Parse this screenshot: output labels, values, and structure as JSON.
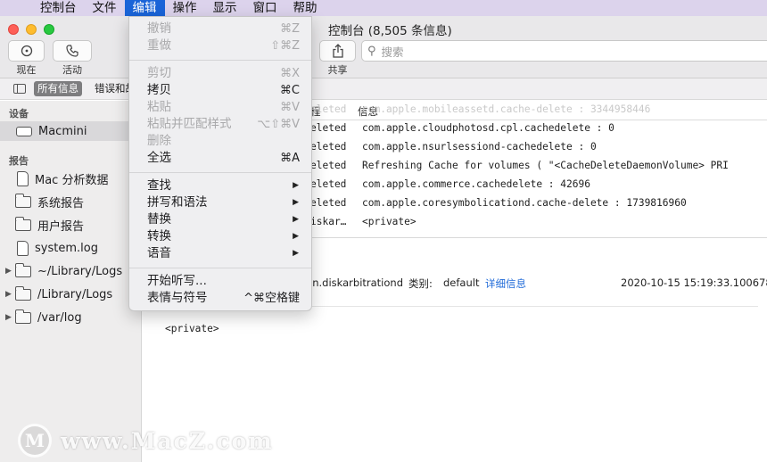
{
  "menubar": {
    "items": [
      {
        "label": "控制台"
      },
      {
        "label": "文件"
      },
      {
        "label": "编辑"
      },
      {
        "label": "操作"
      },
      {
        "label": "显示"
      },
      {
        "label": "窗口"
      },
      {
        "label": "帮助"
      }
    ],
    "active_index": 2
  },
  "window": {
    "title": "控制台 (8,505 条信息)"
  },
  "toolbar": {
    "now_label": "现在",
    "activity_label": "活动",
    "share_label": "共享",
    "search_placeholder": "搜索"
  },
  "filterbar": {
    "all_messages": "所有信息",
    "errors_partial": "错误和故"
  },
  "sidebar": {
    "devices_header": "设备",
    "device": "Macmini",
    "reports_header": "报告",
    "reports": [
      {
        "label": "Mac 分析数据",
        "icon": "document-icon"
      },
      {
        "label": "系统报告",
        "icon": "folder-icon"
      },
      {
        "label": "用户报告",
        "icon": "folder-icon"
      },
      {
        "label": "system.log",
        "icon": "document-icon"
      },
      {
        "label": "~/Library/Logs",
        "icon": "folder-icon",
        "expandable": true
      },
      {
        "label": "/Library/Logs",
        "icon": "folder-icon",
        "expandable": true
      },
      {
        "label": "/var/log",
        "icon": "folder-icon",
        "expandable": true
      }
    ]
  },
  "table": {
    "col_process": "程",
    "col_message": "信息",
    "rows": [
      {
        "c1": "eleted",
        "c2": "com.apple.mobileassetd.cache-delete : 3344958446",
        "faded": true
      },
      {
        "c1": "eleted",
        "c2": "com.apple.cloudphotosd.cpl.cachedelete : 0"
      },
      {
        "c1": "eleted",
        "c2": "com.apple.nsurlsessiond-cachedelete : 0"
      },
      {
        "c1": "eleted",
        "c2": "Refreshing Cache for volumes (     \"<CacheDeleteDaemonVolume> PRI"
      },
      {
        "c1": "eleted",
        "c2": "com.apple.commerce.cachedelete : 42696"
      },
      {
        "c1": "eleted",
        "c2": "com.apple.coresymbolicationd.cache-delete : 1739816960"
      },
      {
        "c1": "iskar…",
        "c2": "<private>"
      }
    ]
  },
  "detail": {
    "process": "ion.diskarbitrationd",
    "category_label": "类别:",
    "category_value": "default",
    "details_link": "详细信息",
    "timestamp": "2020-10-15 15:19:33.100678",
    "message": "<private>"
  },
  "edit_menu": {
    "groups": [
      [
        {
          "label": "撤销",
          "shortcut": "⌘Z",
          "disabled": true
        },
        {
          "label": "重做",
          "shortcut": "⇧⌘Z",
          "disabled": true
        }
      ],
      [
        {
          "label": "剪切",
          "shortcut": "⌘X",
          "disabled": true
        },
        {
          "label": "拷贝",
          "shortcut": "⌘C",
          "disabled": false
        },
        {
          "label": "粘贴",
          "shortcut": "⌘V",
          "disabled": true
        },
        {
          "label": "粘贴并匹配样式",
          "shortcut": "⌥⇧⌘V",
          "disabled": true
        },
        {
          "label": "删除",
          "shortcut": "",
          "disabled": true
        },
        {
          "label": "全选",
          "shortcut": "⌘A",
          "disabled": false
        }
      ],
      [
        {
          "label": "查找",
          "submenu": true
        },
        {
          "label": "拼写和语法",
          "submenu": true
        },
        {
          "label": "替换",
          "submenu": true
        },
        {
          "label": "转换",
          "submenu": true
        },
        {
          "label": "语音",
          "submenu": true
        }
      ],
      [
        {
          "label": "开始听写...",
          "shortcut": ""
        },
        {
          "label": "表情与符号",
          "shortcut": "^⌘空格键"
        }
      ]
    ]
  },
  "watermark": {
    "logo_letter": "M",
    "text": "www.MacZ.com"
  }
}
